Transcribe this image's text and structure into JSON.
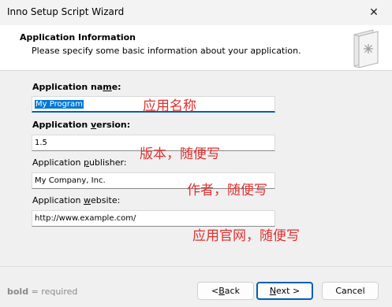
{
  "window": {
    "title": "Inno Setup Script Wizard",
    "close_glyph": "✕"
  },
  "header": {
    "title": "Application Information",
    "subtitle": "Please specify some basic information about your application."
  },
  "form": {
    "name": {
      "label_pre": "Application na",
      "label_accel": "m",
      "label_post": "e:",
      "value": "My Program"
    },
    "version": {
      "label_pre": "Application ",
      "label_accel": "v",
      "label_post": "ersion:",
      "value": "1.5"
    },
    "publisher": {
      "label_pre": "Application ",
      "label_accel": "p",
      "label_post": "ublisher:",
      "value": "My Company, Inc."
    },
    "website": {
      "label_pre": "Application ",
      "label_accel": "w",
      "label_post": "ebsite:",
      "value": "http://www.example.com/"
    }
  },
  "annotations": {
    "name": "应用名称",
    "version": "版本，随便写",
    "publisher": "作者，随便写",
    "website": "应用官网，随便写"
  },
  "footer": {
    "required_bold": "bold",
    "required_text": " = required",
    "back_pre": "< ",
    "back_accel": "B",
    "back_post": "ack",
    "next_accel": "N",
    "next_post": "ext >",
    "cancel": "Cancel"
  },
  "colors": {
    "accent": "#005fb8",
    "annotation": "#e03030"
  },
  "icons": {
    "wizard": "wizard-book-icon",
    "close": "close-icon"
  }
}
